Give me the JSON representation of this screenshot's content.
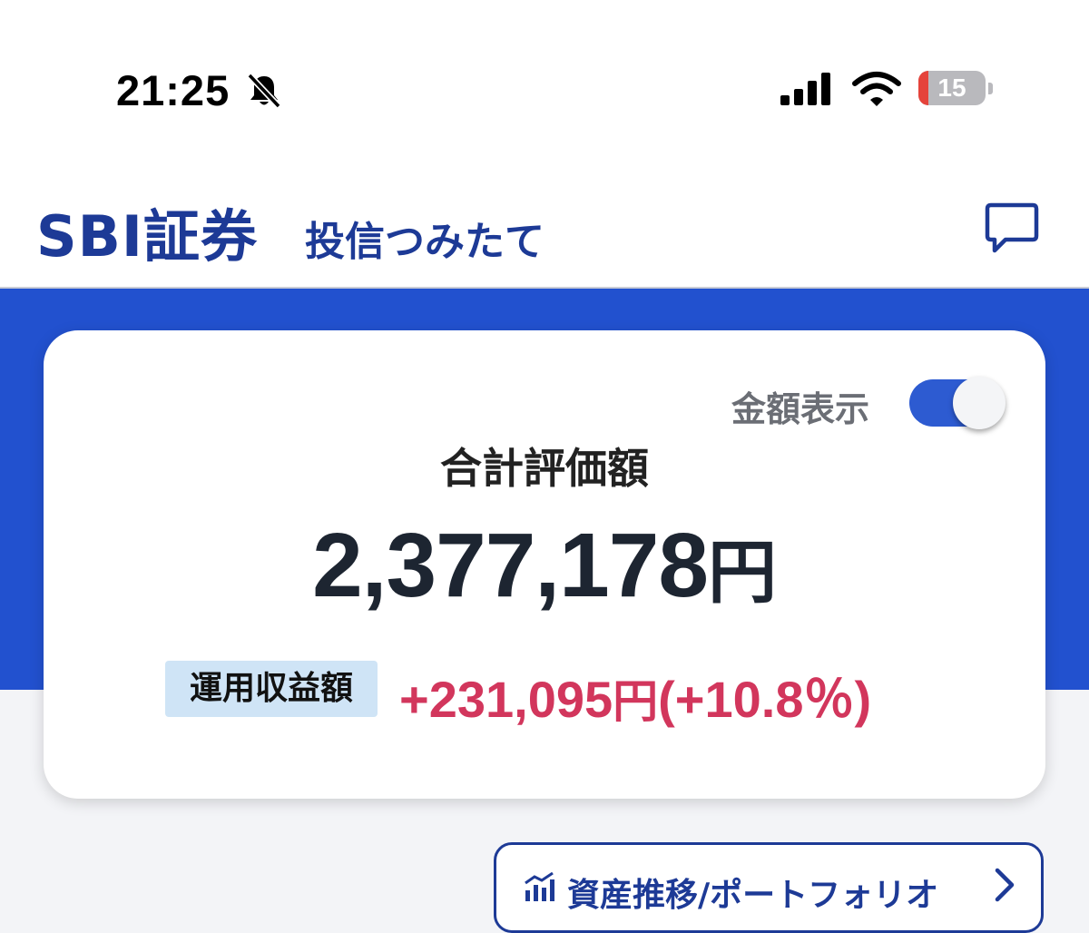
{
  "status_bar": {
    "time": "21:25",
    "battery_percent": "15",
    "battery_level": 0.15,
    "icons": [
      "bell-slash-icon",
      "signal-icon",
      "wifi-icon",
      "battery-icon"
    ]
  },
  "header": {
    "logo": "SBI証券",
    "service_name": "投信つみたて",
    "chat_icon": "chat-bubble-icon"
  },
  "summary": {
    "toggle_label": "金額表示",
    "toggle_on": true,
    "total_label": "合計評価額",
    "total_amount": "2,377,178",
    "total_unit": "円",
    "profit_label": "運用収益額",
    "profit_amount": "+231,095",
    "profit_unit": "円",
    "profit_percent": "(+10.8％)"
  },
  "portfolio_button": {
    "label": "資産推移/ポートフォリオ",
    "icon": "chart-icon"
  },
  "colors": {
    "brand": "#1d3a96",
    "band": "#2251cf",
    "profit": "#d2365c",
    "badge": "#cfe4f6"
  }
}
